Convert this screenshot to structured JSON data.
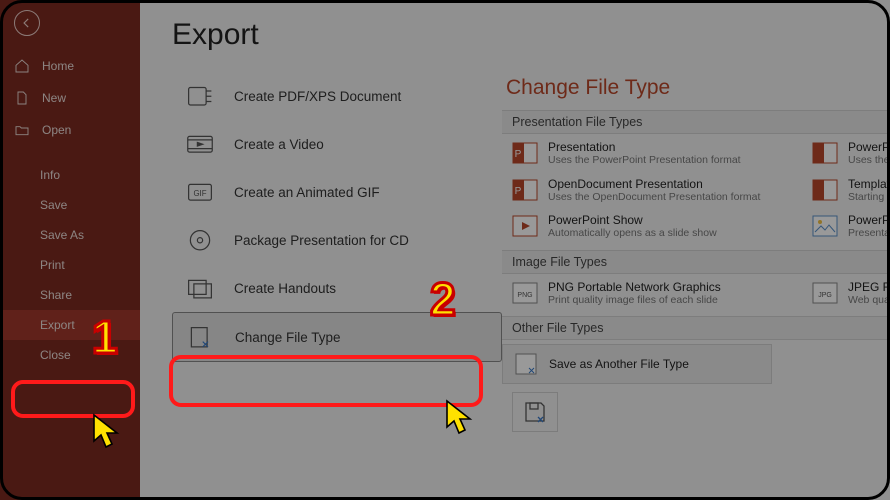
{
  "sidebar": {
    "home": "Home",
    "new": "New",
    "open": "Open",
    "info": "Info",
    "save": "Save",
    "saveas": "Save As",
    "print": "Print",
    "share": "Share",
    "export": "Export",
    "close": "Close"
  },
  "page": {
    "title": "Export"
  },
  "exportOptions": {
    "pdf": "Create PDF/XPS Document",
    "video": "Create a Video",
    "gif": "Create an Animated GIF",
    "package": "Package Presentation for CD",
    "handouts": "Create Handouts",
    "changeFileType": "Change File Type"
  },
  "detail": {
    "title": "Change File Type",
    "presHeader": "Presentation File Types",
    "imgHeader": "Image File Types",
    "otherHeader": "Other File Types",
    "tiles": {
      "presentation": {
        "label": "Presentation",
        "desc": "Uses the PowerPoint Presentation format"
      },
      "ppt9703": {
        "label": "PowerPoint",
        "desc": "Uses the Pow…"
      },
      "odp": {
        "label": "OpenDocument Presentation",
        "desc": "Uses the OpenDocument Presentation format"
      },
      "template": {
        "label": "Template",
        "desc": "Starting poi…"
      },
      "show": {
        "label": "PowerPoint Show",
        "desc": "Automatically opens as a slide show"
      },
      "picpres": {
        "label": "PowerPoint",
        "desc": "Presentation…"
      },
      "png": {
        "label": "PNG Portable Network Graphics",
        "desc": "Print quality image files of each slide"
      },
      "jpeg": {
        "label": "JPEG File In…",
        "desc": "Web quality…"
      },
      "saveAnother": "Save as Another File Type"
    }
  },
  "annotations": {
    "num1": "1",
    "num2": "2"
  }
}
